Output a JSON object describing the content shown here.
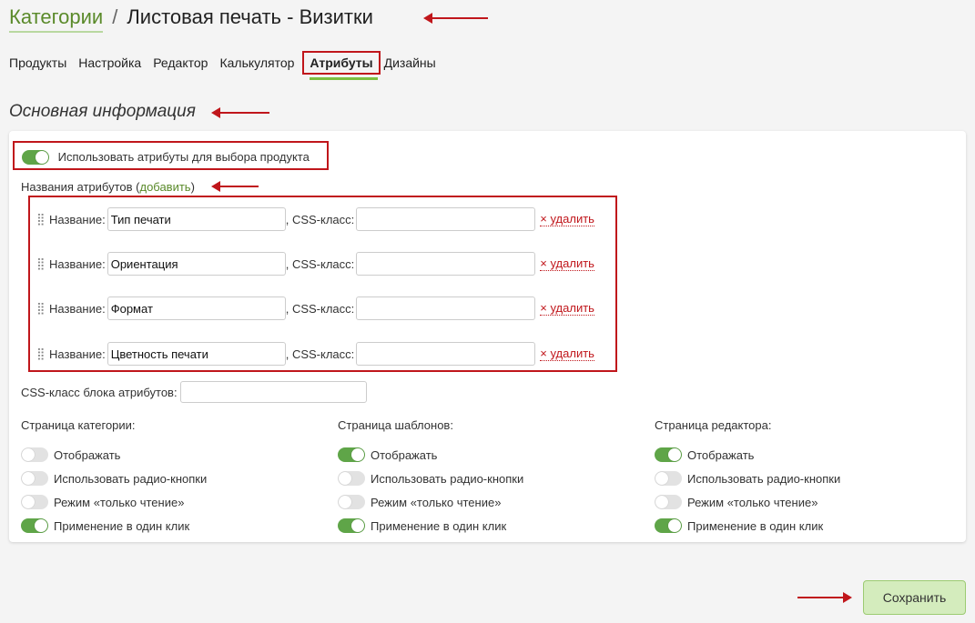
{
  "breadcrumb": {
    "parent": "Категории",
    "separator": "/",
    "current": "Листовая печать - Визитки"
  },
  "tabs": [
    {
      "label": "Продукты"
    },
    {
      "label": "Настройка"
    },
    {
      "label": "Редактор"
    },
    {
      "label": "Калькулятор"
    },
    {
      "label": "Атрибуты",
      "active": true
    },
    {
      "label": "Дизайны"
    }
  ],
  "section_title": "Основная информация",
  "use_attributes": {
    "label": "Использовать атрибуты для выбора продукта",
    "on": true
  },
  "attr_names": {
    "label": "Названия атрибутов",
    "open": "(",
    "add": "добавить",
    "close": ")"
  },
  "attributes": {
    "name_label": "Название:",
    "css_label": ", CSS-класс:",
    "delete_label": "× удалить",
    "items": [
      {
        "name": "Тип печати",
        "css": ""
      },
      {
        "name": "Ориентация",
        "css": ""
      },
      {
        "name": "Формат",
        "css": ""
      },
      {
        "name": "Цветность печати",
        "css": ""
      }
    ]
  },
  "block_css": {
    "label": "CSS-класс блока атрибутов:",
    "value": ""
  },
  "pages": [
    {
      "title": "Страница категории:",
      "options": [
        {
          "label": "Отображать",
          "on": false
        },
        {
          "label": "Использовать радио-кнопки",
          "on": false
        },
        {
          "label": "Режим «только чтение»",
          "on": false
        },
        {
          "label": "Применение в один клик",
          "on": true
        }
      ]
    },
    {
      "title": "Страница шаблонов:",
      "options": [
        {
          "label": "Отображать",
          "on": true
        },
        {
          "label": "Использовать радио-кнопки",
          "on": false
        },
        {
          "label": "Режим «только чтение»",
          "on": false
        },
        {
          "label": "Применение в один клик",
          "on": true
        }
      ]
    },
    {
      "title": "Страница редактора:",
      "options": [
        {
          "label": "Отображать",
          "on": true
        },
        {
          "label": "Использовать радио-кнопки",
          "on": false
        },
        {
          "label": "Режим «только чтение»",
          "on": false
        },
        {
          "label": "Применение в один клик",
          "on": true
        }
      ]
    }
  ],
  "save_label": "Сохранить",
  "colors": {
    "accent": "#5fa548",
    "highlight": "#c0161b",
    "save_bg": "#d4ecbd"
  }
}
